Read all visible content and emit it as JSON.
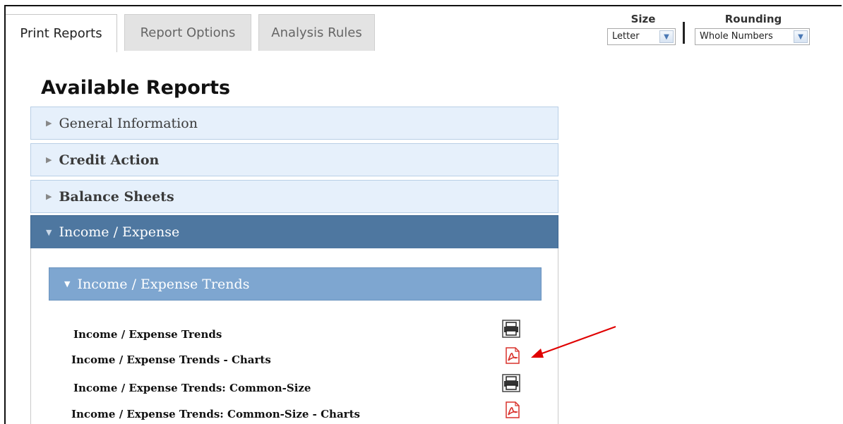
{
  "tabs": [
    {
      "label": "Print Reports",
      "active": true
    },
    {
      "label": "Report Options",
      "active": false
    },
    {
      "label": "Analysis Rules",
      "active": false
    }
  ],
  "controls": {
    "size": {
      "label": "Size",
      "value": "Letter"
    },
    "rounding": {
      "label": "Rounding",
      "value": "Whole Numbers"
    }
  },
  "page": {
    "heading": "Available Reports"
  },
  "sections": [
    {
      "label": "General Information",
      "expanded": false
    },
    {
      "label": "Credit Action",
      "expanded": false
    },
    {
      "label": "Balance Sheets",
      "expanded": false
    },
    {
      "label": "Income / Expense",
      "expanded": true
    }
  ],
  "subsection": {
    "label": "Income / Expense Trends",
    "expanded": true
  },
  "reports": [
    {
      "label": "Income / Expense Trends",
      "icon": "printer-icon"
    },
    {
      "label": "Income / Expense Trends - Charts",
      "icon": "pdf-icon"
    },
    {
      "label": "Income / Expense Trends: Common-Size",
      "icon": "printer-icon"
    },
    {
      "label": "Income / Expense Trends: Common-Size - Charts",
      "icon": "pdf-icon"
    }
  ],
  "colors": {
    "accent_dark": "#4e77a0",
    "accent_light": "#7ea6d0",
    "panel_bg": "#e6f0fb",
    "annotation_arrow": "#e00000",
    "pdf_red": "#d9322c"
  }
}
